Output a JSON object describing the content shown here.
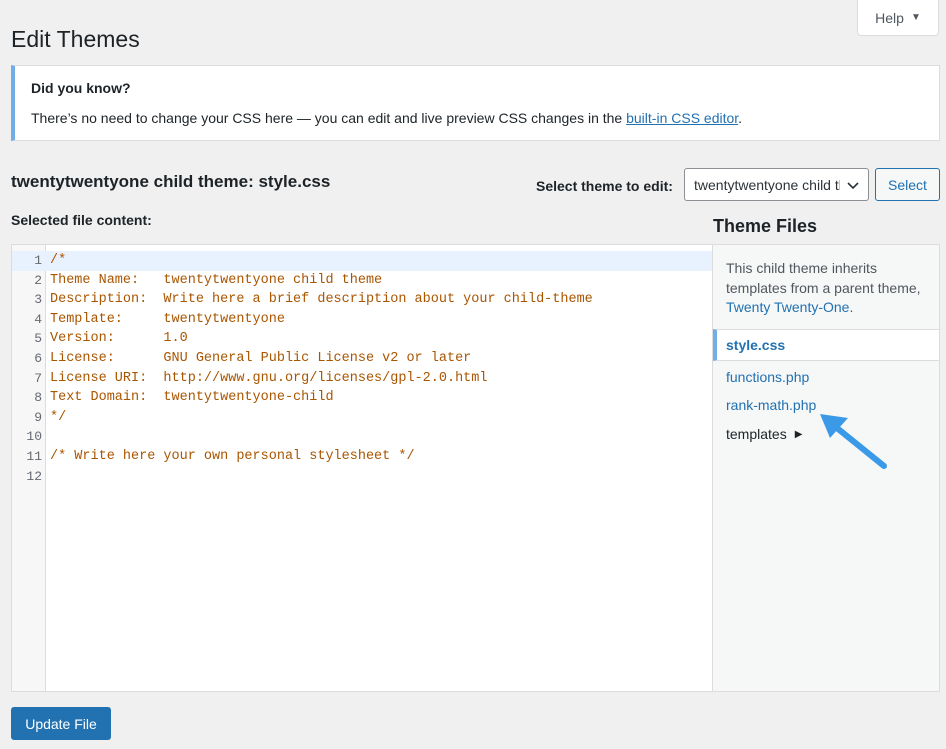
{
  "help_tab": {
    "label": "Help"
  },
  "page_title": "Edit Themes",
  "notice": {
    "title": "Did you know?",
    "text": "There’s no need to change your CSS here — you can edit and live preview CSS changes in the",
    "link": "built-in CSS editor",
    "after_link": "."
  },
  "file_heading": "twentytwentyone child theme: style.css",
  "theme_select": {
    "label": "Select theme to edit:",
    "value": "twentytwentyone child theme",
    "button": "Select"
  },
  "content_label": "Selected file content:",
  "code_lines": [
    {
      "n": "1",
      "t": "/*"
    },
    {
      "n": "2",
      "t": "Theme Name:   twentytwentyone child theme"
    },
    {
      "n": "3",
      "t": "Description:  Write here a brief description about your child-theme"
    },
    {
      "n": "4",
      "t": "Template:     twentytwentyone"
    },
    {
      "n": "5",
      "t": "Version:      1.0"
    },
    {
      "n": "6",
      "t": "License:      GNU General Public License v2 or later"
    },
    {
      "n": "7",
      "t": "License URI:  http://www.gnu.org/licenses/gpl-2.0.html"
    },
    {
      "n": "8",
      "t": "Text Domain:  twentytwentyone-child"
    },
    {
      "n": "9",
      "t": "*/"
    },
    {
      "n": "10",
      "t": ""
    },
    {
      "n": "11",
      "t": "/* Write here your own personal stylesheet */"
    },
    {
      "n": "12",
      "t": ""
    }
  ],
  "theme_files": {
    "title": "Theme Files",
    "note_text": "This child theme inherits templates from a parent theme,",
    "parent_link": "Twenty Twenty-One",
    "note_after": ".",
    "files": [
      "style.css",
      "functions.php",
      "rank-math.php"
    ],
    "folder": "templates"
  },
  "update_button": "Update File",
  "colors": {
    "accent": "#2271b1",
    "notice_border": "#72aee6",
    "code_text": "#aa5500",
    "arrow": "#3b9ae8"
  }
}
